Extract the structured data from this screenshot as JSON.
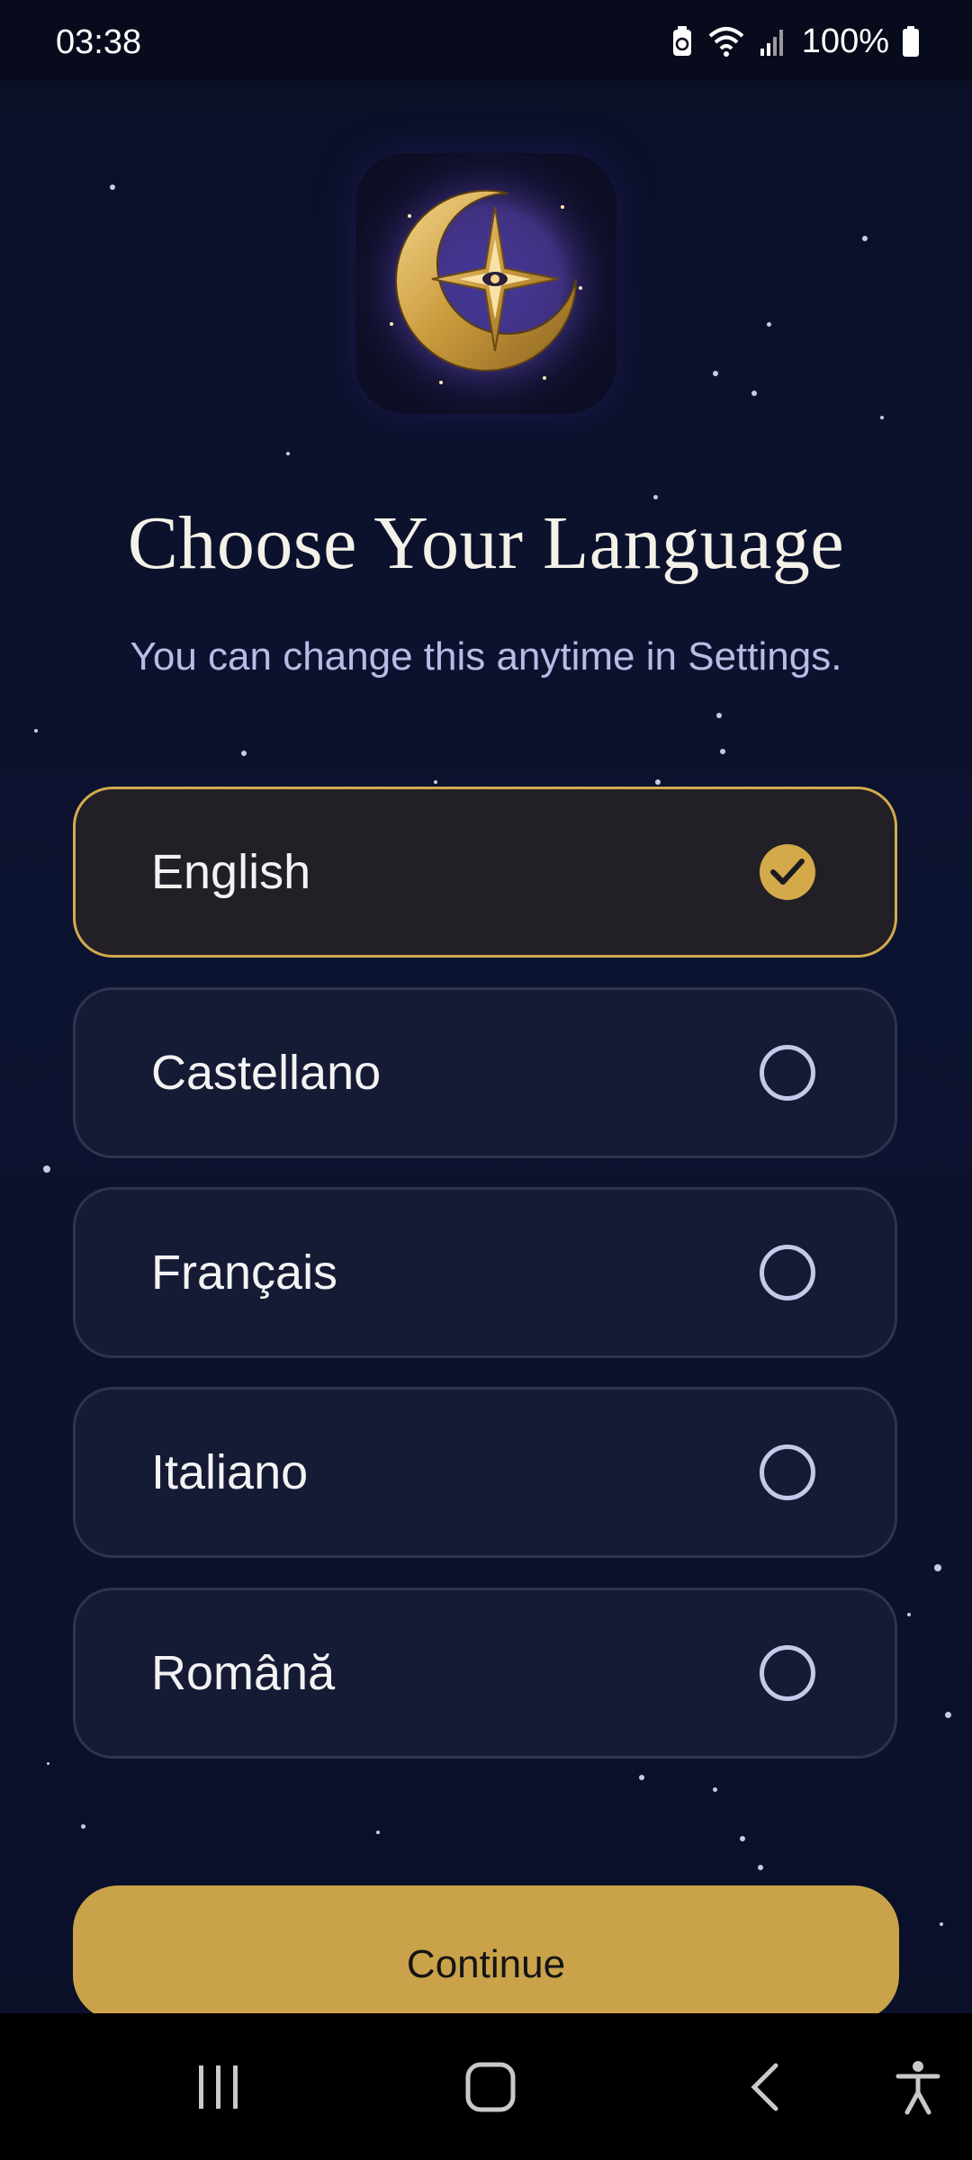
{
  "status_bar": {
    "time": "03:38",
    "battery": "100%",
    "icons": [
      "battery-saver-icon",
      "wifi-icon",
      "signal-icon",
      "battery-icon"
    ]
  },
  "app": {
    "logo": "crescent-moon-star-logo"
  },
  "header": {
    "title": "Choose Your Language",
    "subtitle": "You can change this anytime in Settings."
  },
  "languages": {
    "items": [
      {
        "label": "English",
        "selected": true
      },
      {
        "label": "Castellano",
        "selected": false
      },
      {
        "label": "Français",
        "selected": false
      },
      {
        "label": "Italiano",
        "selected": false
      },
      {
        "label": "Română",
        "selected": false
      }
    ]
  },
  "actions": {
    "continue_label": "Continue"
  },
  "nav_bar": {
    "icons": [
      "recents-icon",
      "home-icon",
      "back-icon",
      "accessibility-icon"
    ]
  },
  "colors": {
    "background": "#0b0f25",
    "accent": "#c9a24a",
    "option_bg": "#151a35",
    "selected_bg": "#221f26",
    "subtitle": "#b9bbe6"
  }
}
